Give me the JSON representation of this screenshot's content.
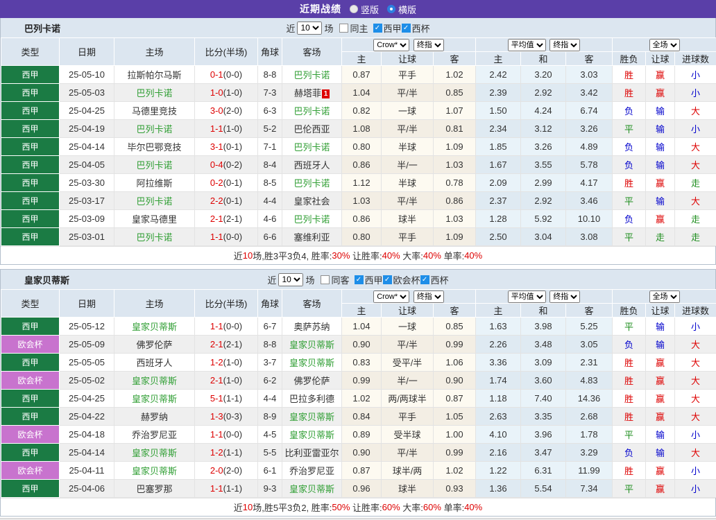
{
  "colors": {
    "topbar_bg": "#5a3fa8",
    "header_bg": "#dce6f0",
    "row_alt_bg": "#efefef",
    "crow_cols_bg": "#fdfaf1",
    "avg_cols_bg": "#e9f3f9",
    "liga_badge": "#1b7b44",
    "uecl_badge": "#c873ce",
    "focus_team": "#2f9e33",
    "score_red": "#dd0000",
    "result_blue": "#0000cc",
    "result_green": "#1e8e1e",
    "checkbox_blue": "#1e8ee8"
  },
  "type_colors": {
    "西甲": "#1b7b44",
    "欧会杯": "#c873ce"
  },
  "result_color_map": {
    "胜": "red",
    "负": "blue",
    "平": "green",
    "赢": "red",
    "输": "blue",
    "走": "green",
    "大": "red",
    "小": "blue"
  },
  "title_bar": {
    "title": "近期战绩",
    "vertical": "竖版",
    "horizontal": "横版"
  },
  "table_header": {
    "type": "类型",
    "date": "日期",
    "home": "主场",
    "score": "比分(半场)",
    "corner": "角球",
    "away": "客场",
    "crow_select": "Crow*",
    "final_select": "终指",
    "avg_select": "平均值",
    "avg_final_select": "终指",
    "full_select": "全场",
    "odds_home": "主",
    "odds_handicap": "让球",
    "odds_away": "客",
    "avg_home": "主",
    "avg_draw": "和",
    "avg_away": "客",
    "res_winlose": "胜负",
    "res_handicap": "让球",
    "res_goals": "进球数"
  },
  "sections": [
    {
      "team": "巴列卡诺",
      "filter": {
        "near": "近",
        "count": "10",
        "games": "场",
        "same": "同主",
        "leagues": [
          "西甲",
          "西杯"
        ]
      },
      "rows": [
        {
          "type": "西甲",
          "date": "25-05-10",
          "home": "拉斯帕尔马斯",
          "home_focus": false,
          "score": "0-1",
          "half": "(0-0)",
          "corner": "8-8",
          "away": "巴列卡诺",
          "away_focus": true,
          "away_badge": "",
          "odds": [
            "0.87",
            "平手",
            "1.02"
          ],
          "avg": [
            "2.42",
            "3.20",
            "3.03"
          ],
          "results": [
            "胜",
            "赢",
            "小"
          ]
        },
        {
          "type": "西甲",
          "date": "25-05-03",
          "home": "巴列卡诺",
          "home_focus": true,
          "score": "1-0",
          "half": "(1-0)",
          "corner": "7-3",
          "away": "赫塔菲",
          "away_focus": false,
          "away_badge": "1",
          "odds": [
            "1.04",
            "平/半",
            "0.85"
          ],
          "avg": [
            "2.39",
            "2.92",
            "3.42"
          ],
          "results": [
            "胜",
            "赢",
            "小"
          ]
        },
        {
          "type": "西甲",
          "date": "25-04-25",
          "home": "马德里竞技",
          "home_focus": false,
          "score": "3-0",
          "half": "(2-0)",
          "corner": "6-3",
          "away": "巴列卡诺",
          "away_focus": true,
          "away_badge": "",
          "odds": [
            "0.82",
            "一球",
            "1.07"
          ],
          "avg": [
            "1.50",
            "4.24",
            "6.74"
          ],
          "results": [
            "负",
            "输",
            "大"
          ]
        },
        {
          "type": "西甲",
          "date": "25-04-19",
          "home": "巴列卡诺",
          "home_focus": true,
          "score": "1-1",
          "half": "(1-0)",
          "corner": "5-2",
          "away": "巴伦西亚",
          "away_focus": false,
          "away_badge": "",
          "odds": [
            "1.08",
            "平/半",
            "0.81"
          ],
          "avg": [
            "2.34",
            "3.12",
            "3.26"
          ],
          "results": [
            "平",
            "输",
            "小"
          ]
        },
        {
          "type": "西甲",
          "date": "25-04-14",
          "home": "毕尔巴鄂竞技",
          "home_focus": false,
          "score": "3-1",
          "half": "(0-1)",
          "corner": "7-1",
          "away": "巴列卡诺",
          "away_focus": true,
          "away_badge": "",
          "odds": [
            "0.80",
            "半球",
            "1.09"
          ],
          "avg": [
            "1.85",
            "3.26",
            "4.89"
          ],
          "results": [
            "负",
            "输",
            "大"
          ]
        },
        {
          "type": "西甲",
          "date": "25-04-05",
          "home": "巴列卡诺",
          "home_focus": true,
          "score": "0-4",
          "half": "(0-2)",
          "corner": "8-4",
          "away": "西班牙人",
          "away_focus": false,
          "away_badge": "",
          "odds": [
            "0.86",
            "半/一",
            "1.03"
          ],
          "avg": [
            "1.67",
            "3.55",
            "5.78"
          ],
          "results": [
            "负",
            "输",
            "大"
          ]
        },
        {
          "type": "西甲",
          "date": "25-03-30",
          "home": "阿拉维斯",
          "home_focus": false,
          "score": "0-2",
          "half": "(0-1)",
          "corner": "8-5",
          "away": "巴列卡诺",
          "away_focus": true,
          "away_badge": "",
          "odds": [
            "1.12",
            "半球",
            "0.78"
          ],
          "avg": [
            "2.09",
            "2.99",
            "4.17"
          ],
          "results": [
            "胜",
            "赢",
            "走"
          ]
        },
        {
          "type": "西甲",
          "date": "25-03-17",
          "home": "巴列卡诺",
          "home_focus": true,
          "score": "2-2",
          "half": "(0-1)",
          "corner": "4-4",
          "away": "皇家社会",
          "away_focus": false,
          "away_badge": "",
          "odds": [
            "1.03",
            "平/半",
            "0.86"
          ],
          "avg": [
            "2.37",
            "2.92",
            "3.46"
          ],
          "results": [
            "平",
            "输",
            "大"
          ]
        },
        {
          "type": "西甲",
          "date": "25-03-09",
          "home": "皇家马德里",
          "home_focus": false,
          "score": "2-1",
          "half": "(2-1)",
          "corner": "4-6",
          "away": "巴列卡诺",
          "away_focus": true,
          "away_badge": "",
          "odds": [
            "0.86",
            "球半",
            "1.03"
          ],
          "avg": [
            "1.28",
            "5.92",
            "10.10"
          ],
          "results": [
            "负",
            "赢",
            "走"
          ]
        },
        {
          "type": "西甲",
          "date": "25-03-01",
          "home": "巴列卡诺",
          "home_focus": true,
          "score": "1-1",
          "half": "(0-0)",
          "corner": "6-6",
          "away": "塞维利亚",
          "away_focus": false,
          "away_badge": "",
          "odds": [
            "0.80",
            "平手",
            "1.09"
          ],
          "avg": [
            "2.50",
            "3.04",
            "3.08"
          ],
          "results": [
            "平",
            "走",
            "走"
          ]
        }
      ],
      "footer": [
        {
          "t": "近",
          "c": "k"
        },
        {
          "t": "10",
          "c": "r"
        },
        {
          "t": "场,胜3平3负4, 胜率:",
          "c": "k"
        },
        {
          "t": "30%",
          "c": "r"
        },
        {
          "t": " 让胜率:",
          "c": "k"
        },
        {
          "t": "40%",
          "c": "r"
        },
        {
          "t": " 大率:",
          "c": "k"
        },
        {
          "t": "40%",
          "c": "r"
        },
        {
          "t": " 单率:",
          "c": "k"
        },
        {
          "t": "40%",
          "c": "r"
        }
      ]
    },
    {
      "team": "皇家贝蒂斯",
      "filter": {
        "near": "近",
        "count": "10",
        "games": "场",
        "same": "同客",
        "leagues": [
          "西甲",
          "欧会杯",
          "西杯"
        ]
      },
      "rows": [
        {
          "type": "西甲",
          "date": "25-05-12",
          "home": "皇家贝蒂斯",
          "home_focus": true,
          "score": "1-1",
          "half": "(0-0)",
          "corner": "6-7",
          "away": "奥萨苏纳",
          "away_focus": false,
          "away_badge": "",
          "odds": [
            "1.04",
            "一球",
            "0.85"
          ],
          "avg": [
            "1.63",
            "3.98",
            "5.25"
          ],
          "results": [
            "平",
            "输",
            "小"
          ]
        },
        {
          "type": "欧会杯",
          "date": "25-05-09",
          "home": "佛罗伦萨",
          "home_focus": false,
          "score": "2-1",
          "half": "(2-1)",
          "corner": "8-8",
          "away": "皇家贝蒂斯",
          "away_focus": true,
          "away_badge": "",
          "odds": [
            "0.90",
            "平/半",
            "0.99"
          ],
          "avg": [
            "2.26",
            "3.48",
            "3.05"
          ],
          "results": [
            "负",
            "输",
            "大"
          ]
        },
        {
          "type": "西甲",
          "date": "25-05-05",
          "home": "西班牙人",
          "home_focus": false,
          "score": "1-2",
          "half": "(1-0)",
          "corner": "3-7",
          "away": "皇家贝蒂斯",
          "away_focus": true,
          "away_badge": "",
          "odds": [
            "0.83",
            "受平/半",
            "1.06"
          ],
          "avg": [
            "3.36",
            "3.09",
            "2.31"
          ],
          "results": [
            "胜",
            "赢",
            "大"
          ]
        },
        {
          "type": "欧会杯",
          "date": "25-05-02",
          "home": "皇家贝蒂斯",
          "home_focus": true,
          "score": "2-1",
          "half": "(1-0)",
          "corner": "6-2",
          "away": "佛罗伦萨",
          "away_focus": false,
          "away_badge": "",
          "odds": [
            "0.99",
            "半/一",
            "0.90"
          ],
          "avg": [
            "1.74",
            "3.60",
            "4.83"
          ],
          "results": [
            "胜",
            "赢",
            "大"
          ]
        },
        {
          "type": "西甲",
          "date": "25-04-25",
          "home": "皇家贝蒂斯",
          "home_focus": true,
          "score": "5-1",
          "half": "(1-1)",
          "corner": "4-4",
          "away": "巴拉多利德",
          "away_focus": false,
          "away_badge": "",
          "odds": [
            "1.02",
            "两/两球半",
            "0.87"
          ],
          "avg": [
            "1.18",
            "7.40",
            "14.36"
          ],
          "results": [
            "胜",
            "赢",
            "大"
          ]
        },
        {
          "type": "西甲",
          "date": "25-04-22",
          "home": "赫罗纳",
          "home_focus": false,
          "score": "1-3",
          "half": "(0-3)",
          "corner": "8-9",
          "away": "皇家贝蒂斯",
          "away_focus": true,
          "away_badge": "",
          "odds": [
            "0.84",
            "平手",
            "1.05"
          ],
          "avg": [
            "2.63",
            "3.35",
            "2.68"
          ],
          "results": [
            "胜",
            "赢",
            "大"
          ]
        },
        {
          "type": "欧会杯",
          "date": "25-04-18",
          "home": "乔治罗尼亚",
          "home_focus": false,
          "score": "1-1",
          "half": "(0-0)",
          "corner": "4-5",
          "away": "皇家贝蒂斯",
          "away_focus": true,
          "away_badge": "",
          "odds": [
            "0.89",
            "受半球",
            "1.00"
          ],
          "avg": [
            "4.10",
            "3.96",
            "1.78"
          ],
          "results": [
            "平",
            "输",
            "小"
          ]
        },
        {
          "type": "西甲",
          "date": "25-04-14",
          "home": "皇家贝蒂斯",
          "home_focus": true,
          "score": "1-2",
          "half": "(1-1)",
          "corner": "5-5",
          "away": "比利亚雷亚尔",
          "away_focus": false,
          "away_badge": "",
          "odds": [
            "0.90",
            "平/半",
            "0.99"
          ],
          "avg": [
            "2.16",
            "3.47",
            "3.29"
          ],
          "results": [
            "负",
            "输",
            "大"
          ]
        },
        {
          "type": "欧会杯",
          "date": "25-04-11",
          "home": "皇家贝蒂斯",
          "home_focus": true,
          "score": "2-0",
          "half": "(2-0)",
          "corner": "6-1",
          "away": "乔治罗尼亚",
          "away_focus": false,
          "away_badge": "",
          "odds": [
            "0.87",
            "球半/两",
            "1.02"
          ],
          "avg": [
            "1.22",
            "6.31",
            "11.99"
          ],
          "results": [
            "胜",
            "赢",
            "小"
          ]
        },
        {
          "type": "西甲",
          "date": "25-04-06",
          "home": "巴塞罗那",
          "home_focus": false,
          "score": "1-1",
          "half": "(1-1)",
          "corner": "9-3",
          "away": "皇家贝蒂斯",
          "away_focus": true,
          "away_badge": "",
          "odds": [
            "0.96",
            "球半",
            "0.93"
          ],
          "avg": [
            "1.36",
            "5.54",
            "7.34"
          ],
          "results": [
            "平",
            "赢",
            "小"
          ]
        }
      ],
      "footer": [
        {
          "t": "近",
          "c": "k"
        },
        {
          "t": "10",
          "c": "r"
        },
        {
          "t": "场,胜5平3负2, 胜率:",
          "c": "k"
        },
        {
          "t": "50%",
          "c": "r"
        },
        {
          "t": " 让胜率:",
          "c": "k"
        },
        {
          "t": "60%",
          "c": "r"
        },
        {
          "t": " 大率:",
          "c": "k"
        },
        {
          "t": "60%",
          "c": "r"
        },
        {
          "t": " 单率:",
          "c": "k"
        },
        {
          "t": "40%",
          "c": "r"
        }
      ]
    }
  ]
}
